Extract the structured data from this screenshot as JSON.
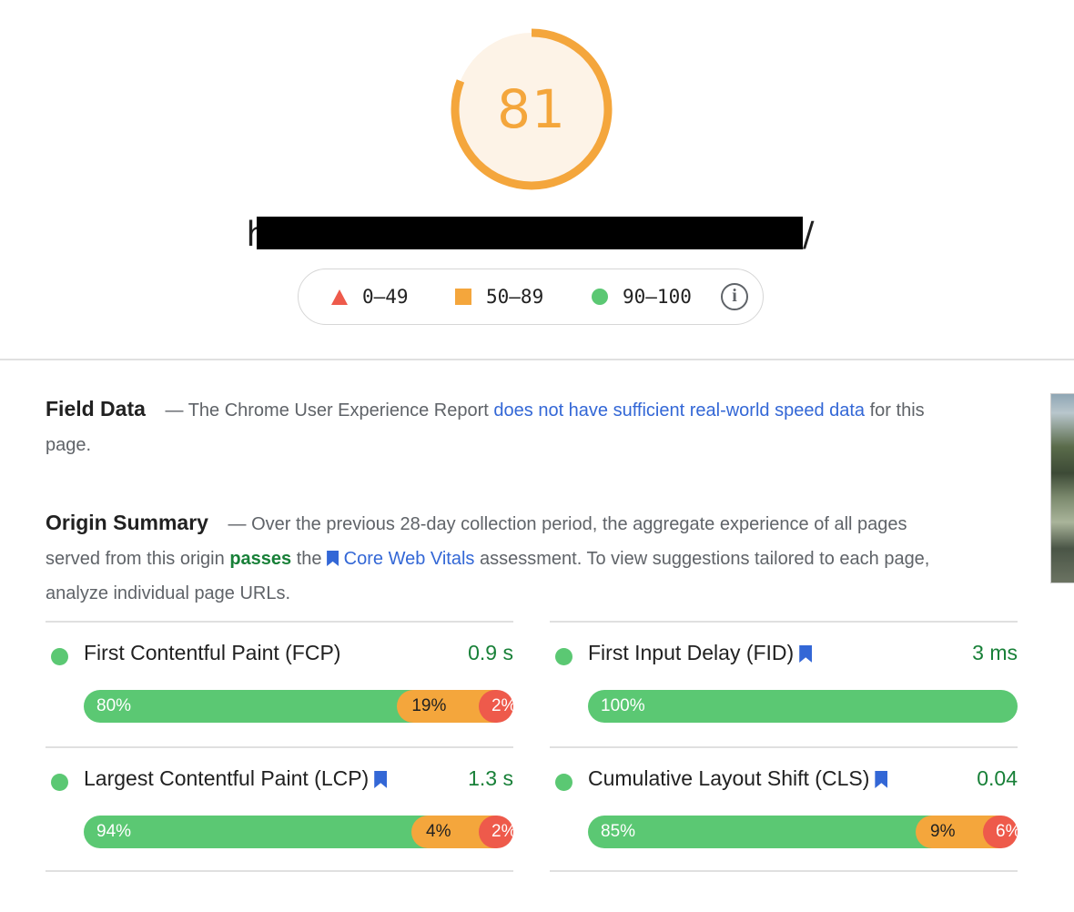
{
  "score": {
    "value": "81",
    "fraction": 0.81,
    "color": "#f4a63c",
    "track_color": "#fdf3e7"
  },
  "url": {
    "visible_start": "h",
    "visible_end": "/"
  },
  "legend": {
    "items": [
      {
        "icon": "red-triangle-icon",
        "label": "0–49",
        "color": "#ee5a4b"
      },
      {
        "icon": "orange-square-icon",
        "label": "50–89",
        "color": "#f4a63c"
      },
      {
        "icon": "green-circle-icon",
        "label": "90–100",
        "color": "#5bc873"
      }
    ],
    "info_glyph": "i"
  },
  "field_data": {
    "title": "Field Data",
    "dash": "—",
    "text_before": "The Chrome User Experience Report",
    "link": "does not have sufficient real-world speed data",
    "text_after": "for this page."
  },
  "origin_summary": {
    "title": "Origin Summary",
    "dash": "—",
    "text_1": "Over the previous 28-day collection period, the aggregate experience of all pages served from this origin",
    "passes": "passes",
    "text_2": "the",
    "cwv_link": "Core Web Vitals",
    "text_3": "assessment. To view suggestions tailored to each page, analyze individual page URLs."
  },
  "metrics": [
    {
      "name": "First Contentful Paint (FCP)",
      "bookmark": false,
      "value": "0.9 s",
      "distribution": {
        "good": "80%",
        "average": "19%",
        "poor": "2%"
      },
      "fractions": {
        "good": 80,
        "average": 19,
        "poor": 2
      }
    },
    {
      "name": "First Input Delay (FID)",
      "bookmark": true,
      "value": "3 ms",
      "distribution": {
        "good": "100%",
        "average": "",
        "poor": ""
      },
      "fractions": {
        "good": 100,
        "average": 0,
        "poor": 0
      }
    },
    {
      "name": "Largest Contentful Paint (LCP)",
      "bookmark": true,
      "value": "1.3 s",
      "distribution": {
        "good": "94%",
        "average": "4%",
        "poor": "2%"
      },
      "fractions": {
        "good": 94,
        "average": 4,
        "poor": 2
      }
    },
    {
      "name": "Cumulative Layout Shift (CLS)",
      "bookmark": true,
      "value": "0.04",
      "distribution": {
        "good": "85%",
        "average": "9%",
        "poor": "6%"
      },
      "fractions": {
        "good": 85,
        "average": 9,
        "poor": 6
      }
    }
  ],
  "colors": {
    "good": "#5bc873",
    "average": "#f4a63c",
    "poor": "#ee5a4b",
    "link": "#3367d6",
    "pass": "#188038"
  }
}
